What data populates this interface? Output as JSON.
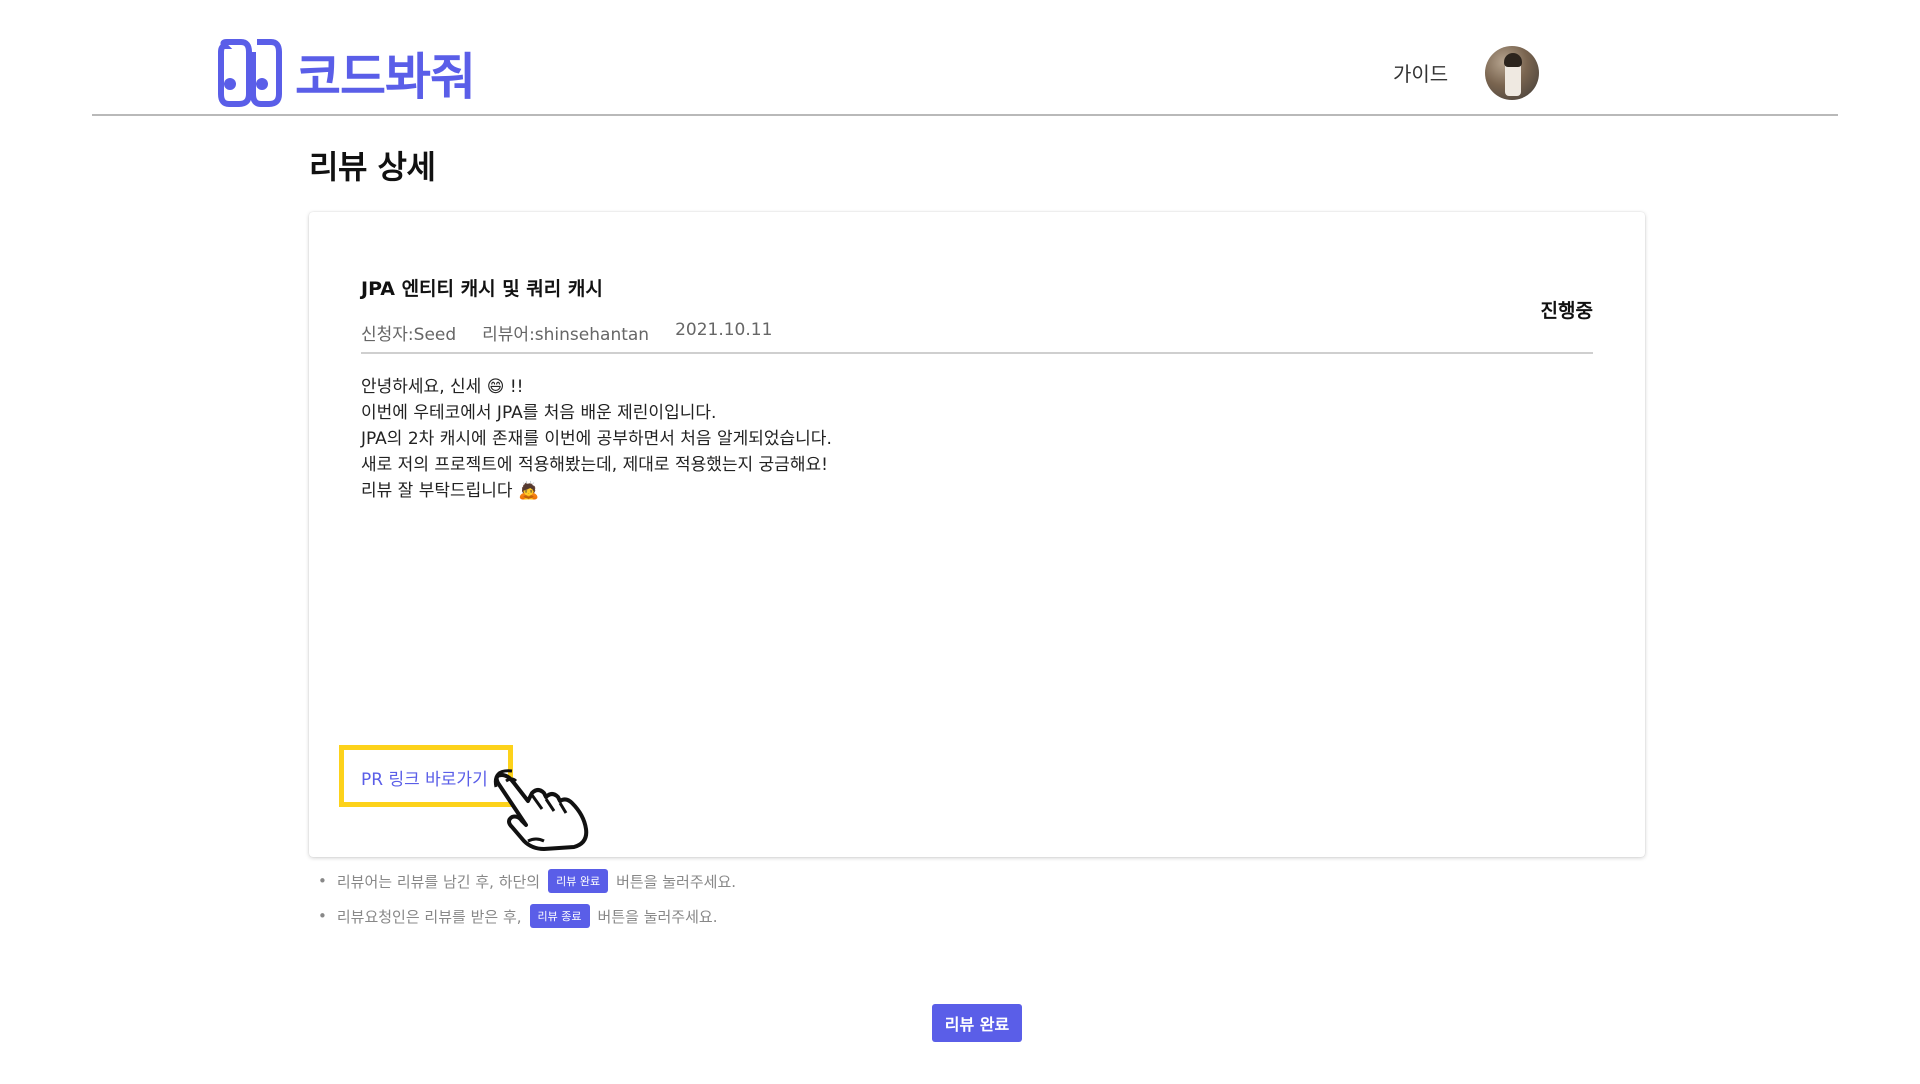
{
  "header": {
    "logo_text": "코드봐줘",
    "nav_guide": "가이드"
  },
  "page": {
    "title": "리뷰 상세"
  },
  "review": {
    "title": "JPA 엔티티 캐시 및 쿼리 캐시",
    "requester": "신청자:Seed",
    "reviewer": "리뷰어:shinsehantan",
    "date": "2021.10.11",
    "status": "진행중",
    "content": [
      "안녕하세요, 신세 😄 !!",
      "이번에 우테코에서 JPA를 처음 배운 제린이입니다.",
      "JPA의 2차 캐시에 존재를 이번에 공부하면서 처음 알게되었습니다.",
      "새로 저의 프로젝트에 적용해봤는데, 제대로 적용했는지 궁금해요!",
      "리뷰 잘 부탁드립니다 🙇"
    ],
    "pr_link": "PR 링크 바로가기"
  },
  "notes": [
    {
      "bullet": "•",
      "before": "리뷰어는 리뷰를 남긴 후, 하단의",
      "chip": "리뷰 완료",
      "after": "버튼을 눌러주세요."
    },
    {
      "bullet": "•",
      "before": "리뷰요청인은 리뷰를 받은 후,",
      "chip": "리뷰 종료",
      "after": "버튼을 눌러주세요."
    }
  ],
  "actions": {
    "complete_label": "리뷰 완료"
  },
  "colors": {
    "brand": "#5a5ee8",
    "highlight": "#fdd21a"
  }
}
